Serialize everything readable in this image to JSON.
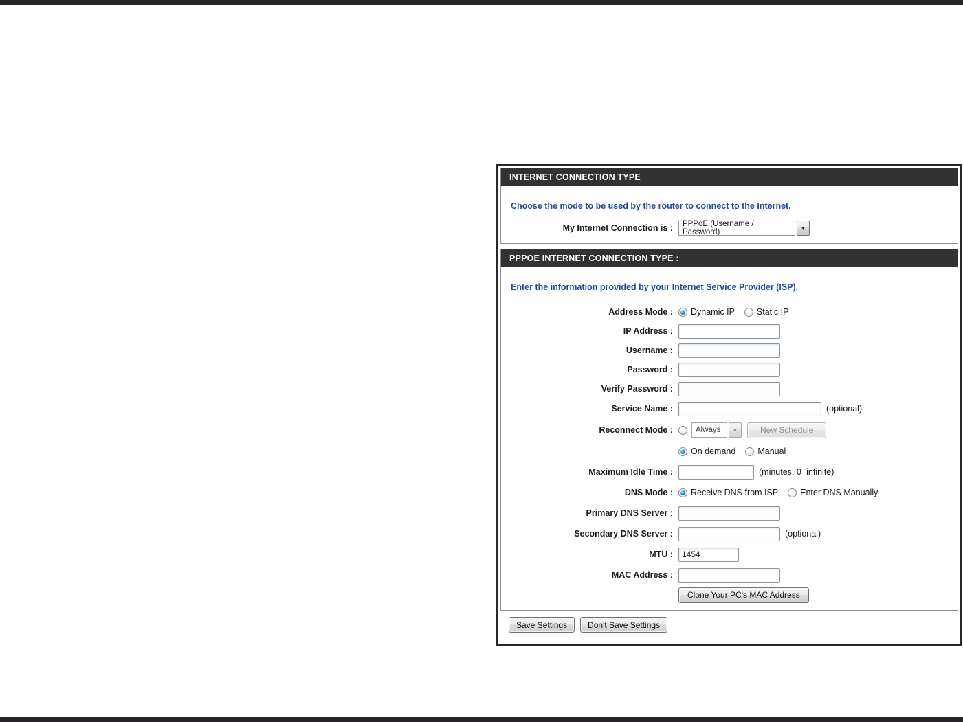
{
  "section1": {
    "header": "INTERNET CONNECTION TYPE",
    "description": "Choose the mode to be used by the router to connect to the Internet.",
    "my_connection_label": "My Internet Connection is :",
    "my_connection_value": "PPPoE (Username / Password)",
    "dropdown_arrow": "▼"
  },
  "section2": {
    "header": "PPPOE INTERNET CONNECTION TYPE :",
    "description": "Enter the information provided by your Internet Service Provider (ISP).",
    "address_mode_label": "Address Mode :",
    "dynamic_ip_option": "Dynamic IP",
    "static_ip_option": "Static IP",
    "ip_address_label": "IP Address :",
    "username_label": "Username :",
    "password_label": "Password :",
    "verify_password_label": "Verify Password :",
    "service_name_label": "Service Name :",
    "service_name_note": "(optional)",
    "reconnect_mode_label": "Reconnect Mode :",
    "reconnect_always_value": "Always",
    "reconnect_arrow": "▼",
    "new_schedule_button": "New Schedule",
    "on_demand_option": "On demand",
    "manual_option": "Manual",
    "max_idle_label": "Maximum Idle Time :",
    "max_idle_note": "(minutes, 0=infinite)",
    "dns_mode_label": "DNS Mode :",
    "receive_dns_option": "Receive DNS from ISP",
    "enter_dns_option": "Enter DNS Manually",
    "primary_dns_label": "Primary DNS Server :",
    "secondary_dns_label": "Secondary DNS Server :",
    "secondary_dns_note": "(optional)",
    "mtu_label": "MTU :",
    "mtu_value": "1454",
    "mac_address_label": "MAC Address :",
    "clone_mac_button": "Clone Your PC's MAC Address"
  },
  "footer": {
    "save_button": "Save Settings",
    "dont_save_button": "Don't Save Settings"
  },
  "colors": {
    "section_header_bg": "#343135",
    "description_blue": "#1e4b9e",
    "frame_dark": "#2b272b"
  }
}
